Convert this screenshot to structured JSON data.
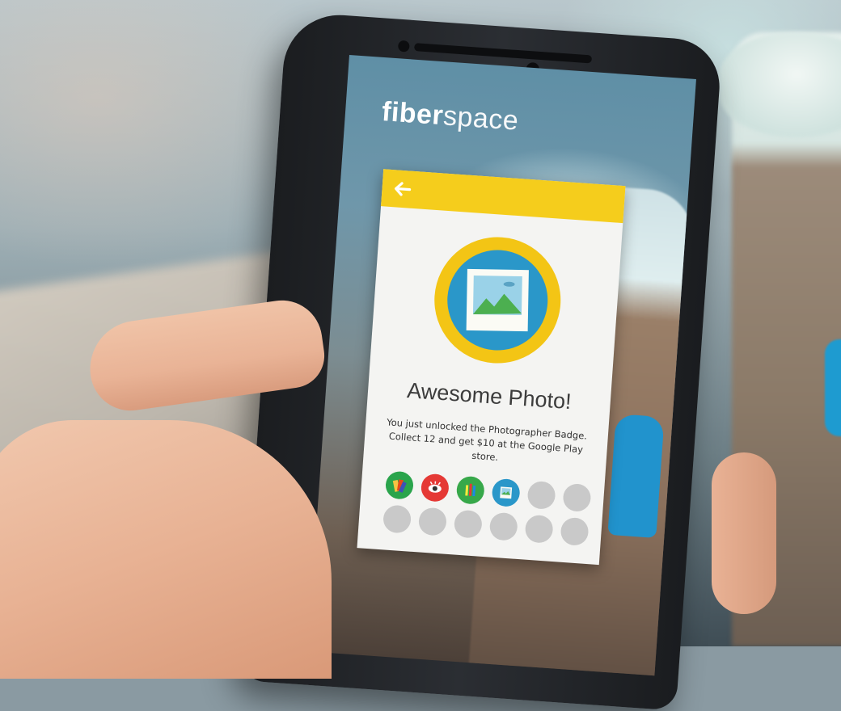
{
  "app": {
    "logo_bold": "fiber",
    "logo_light": "space"
  },
  "card": {
    "back_icon": "arrow-left-icon",
    "badge_icon": "photo-badge-icon",
    "title": "Awesome Photo!",
    "description": "You just unlocked the Photographer Badge. Collect 12 and get $10 at the Google Play store.",
    "badges": [
      {
        "name": "palette-badge",
        "state": "unlocked",
        "color": "#2aa44c"
      },
      {
        "name": "eye-badge",
        "state": "unlocked",
        "color": "#e53935"
      },
      {
        "name": "pencils-badge",
        "state": "unlocked",
        "color": "#37a84a"
      },
      {
        "name": "photo-badge",
        "state": "unlocked",
        "color": "#2a97c9"
      },
      {
        "name": "badge-5",
        "state": "locked"
      },
      {
        "name": "badge-6",
        "state": "locked"
      },
      {
        "name": "badge-7",
        "state": "locked"
      },
      {
        "name": "badge-8",
        "state": "locked"
      },
      {
        "name": "badge-9",
        "state": "locked"
      },
      {
        "name": "badge-10",
        "state": "locked"
      },
      {
        "name": "badge-11",
        "state": "locked"
      },
      {
        "name": "badge-12",
        "state": "locked"
      }
    ],
    "colors": {
      "header": "#f5cd1c",
      "badge_ring": "#f3c515",
      "badge_fill": "#2a97c9"
    }
  }
}
